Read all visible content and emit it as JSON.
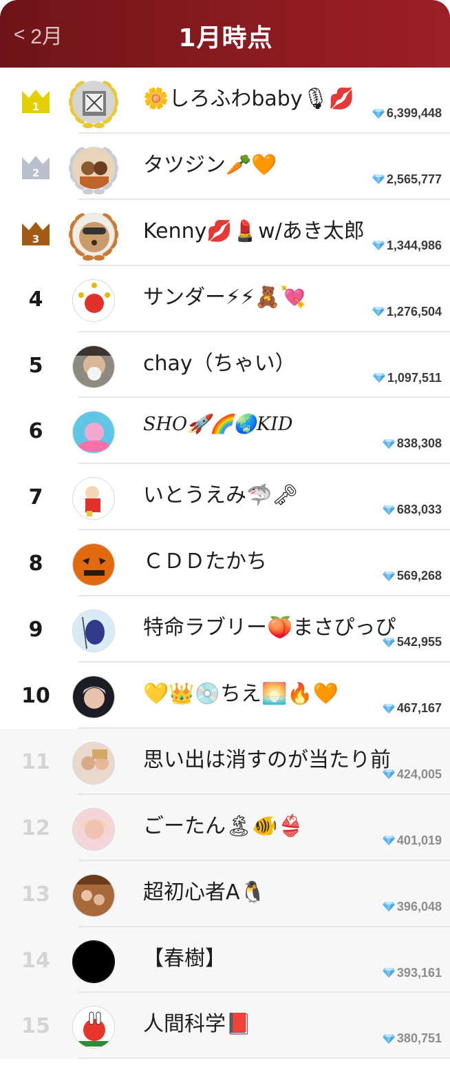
{
  "header": {
    "back_label": "2月",
    "title": "1月時点"
  },
  "colors": {
    "header_start": "#6e1418",
    "header_end": "#9c1f26",
    "gold": "#e4d000",
    "silver": "#b7c0cc",
    "bronze": "#a35a12"
  },
  "ranking": [
    {
      "rank": "1",
      "name": "🌼しろふわbaby🎙💋",
      "score": "6,399,448"
    },
    {
      "rank": "2",
      "name": "タツジン🥕🧡",
      "score": "2,565,777"
    },
    {
      "rank": "3",
      "name": "Kenny💋💄w/あき太郎",
      "score": "1,344,986"
    },
    {
      "rank": "4",
      "name": "サンダー⚡⚡🧸💘",
      "score": "1,276,504"
    },
    {
      "rank": "5",
      "name": "chay（ちゃい）",
      "score": "1,097,511"
    },
    {
      "rank": "6",
      "name": "SHO🚀🌈🌏KID",
      "score": "838,308"
    },
    {
      "rank": "7",
      "name": "いとうえみ🦈🗝",
      "score": "683,033"
    },
    {
      "rank": "8",
      "name": "ＣＤＤたかち",
      "score": "569,268"
    },
    {
      "rank": "9",
      "name": "特命ラブリー🍑まさぴっぴ",
      "score": "542,955"
    },
    {
      "rank": "10",
      "name": "💛👑💿ちえ🌅🔥🧡",
      "score": "467,167"
    },
    {
      "rank": "11",
      "name": "思い出は消すのが当たり前",
      "score": "424,005"
    },
    {
      "rank": "12",
      "name": "ごーたん🏝🐠👙",
      "score": "401,019"
    },
    {
      "rank": "13",
      "name": "超初心者A🐧",
      "score": "396,048"
    },
    {
      "rank": "14",
      "name": "【春樹】",
      "score": "393,161"
    },
    {
      "rank": "15",
      "name": "人間科学📕",
      "score": "380,751"
    }
  ]
}
